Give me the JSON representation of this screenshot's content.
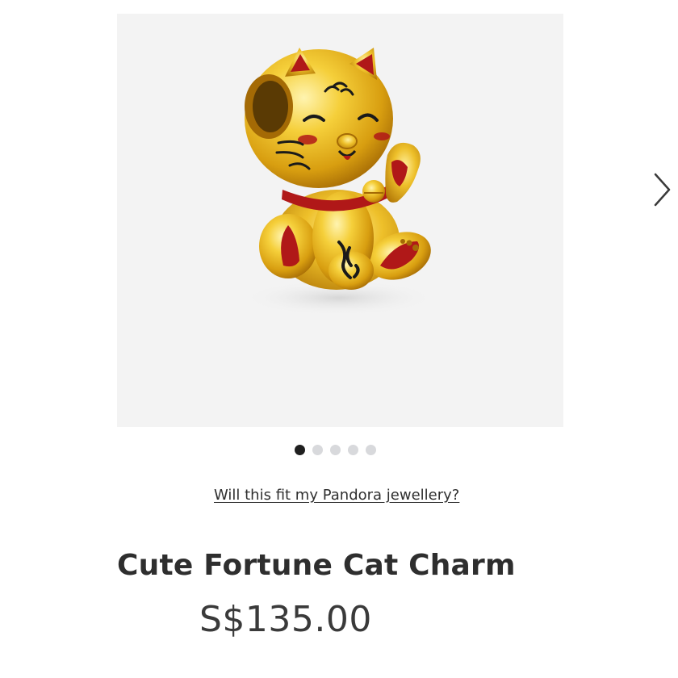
{
  "gallery": {
    "image_icon": "fortune-cat-charm-image",
    "next_icon": "chevron-right-icon",
    "dot_count": 5,
    "active_dot_index": 0
  },
  "fit_link": "Will this fit my Pandora jewellery?",
  "product": {
    "title": "Cute Fortune Cat Charm",
    "price": "S$135.00"
  },
  "colors": {
    "gallery_bg": "#f3f3f3",
    "gold": "#e3b420",
    "enamel_red": "#b01818",
    "dot_active": "#1f1f1f",
    "dot_inactive": "#d8d9dc"
  }
}
